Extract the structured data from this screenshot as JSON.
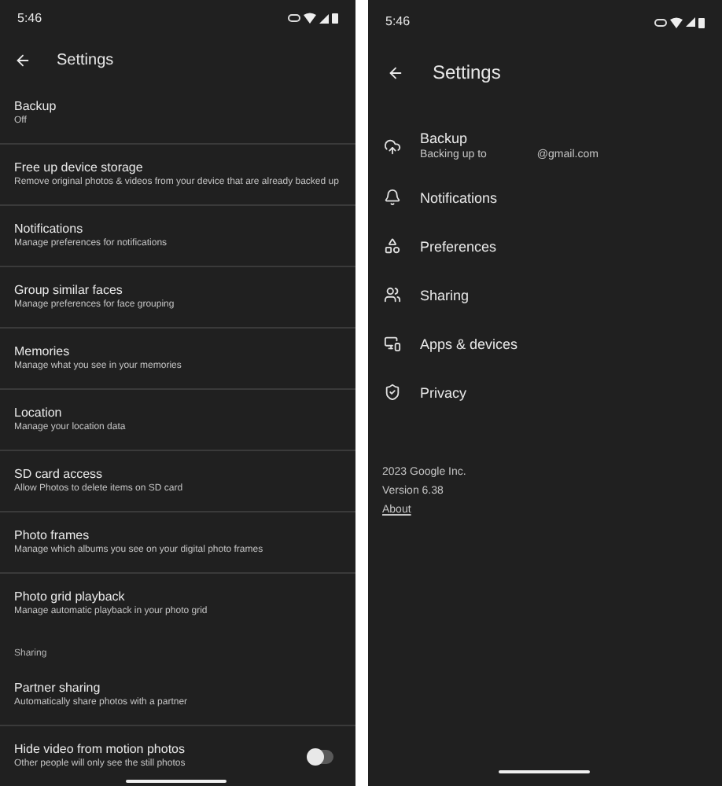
{
  "left_screen": {
    "status_bar": {
      "time": "5:46"
    },
    "title": "Settings",
    "items": [
      {
        "kind": "row",
        "title": "Backup",
        "subtitle": "Off"
      },
      {
        "kind": "row",
        "title": "Free up device storage",
        "subtitle": "Remove original photos & videos from your device that are already backed up"
      },
      {
        "kind": "row",
        "title": "Notifications",
        "subtitle": "Manage preferences for notifications"
      },
      {
        "kind": "row",
        "title": "Group similar faces",
        "subtitle": "Manage preferences for face grouping"
      },
      {
        "kind": "row",
        "title": "Memories",
        "subtitle": "Manage what you see in your memories"
      },
      {
        "kind": "row",
        "title": "Location",
        "subtitle": "Manage your location data"
      },
      {
        "kind": "row",
        "title": "SD card access",
        "subtitle": "Allow Photos to delete items on SD card"
      },
      {
        "kind": "row",
        "title": "Photo frames",
        "subtitle": "Manage which albums you see on your digital photo frames"
      },
      {
        "kind": "row",
        "title": "Photo grid playback",
        "subtitle": "Manage automatic playback in your photo grid"
      },
      {
        "kind": "section",
        "title": "Sharing"
      },
      {
        "kind": "row",
        "title": "Partner sharing",
        "subtitle": "Automatically share photos with a partner"
      },
      {
        "kind": "toggle",
        "title": "Hide video from motion photos",
        "subtitle": "Other people will only see the still photos",
        "on": false
      }
    ]
  },
  "right_screen": {
    "status_bar": {
      "time": "5:46"
    },
    "title": "Settings",
    "items": [
      {
        "title": "Backup",
        "subtitle": "Backing up to",
        "subtitle_2": "@gmail.com"
      },
      {
        "title": "Notifications"
      },
      {
        "title": "Preferences"
      },
      {
        "title": "Sharing"
      },
      {
        "title": "Apps & devices"
      },
      {
        "title": "Privacy"
      }
    ],
    "footer": {
      "copyright": "2023 Google Inc.",
      "version": "Version 6.38",
      "link": "About"
    }
  }
}
